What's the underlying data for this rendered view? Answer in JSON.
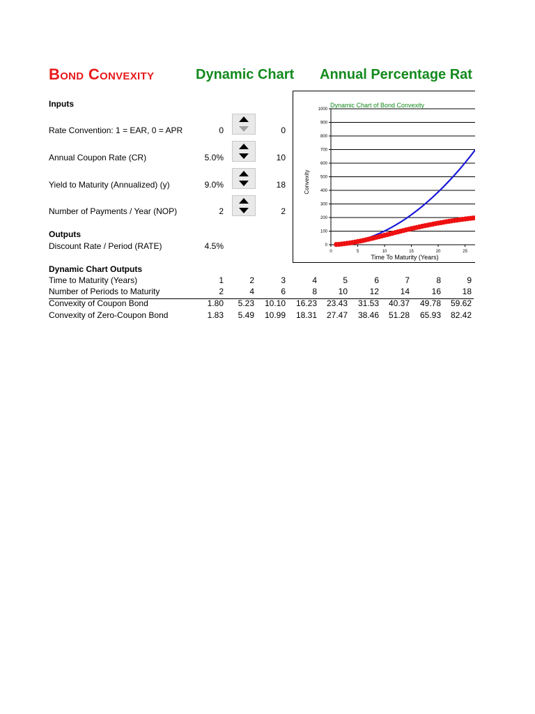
{
  "header": {
    "title": "Bond Convexity",
    "dynamic_chart": "Dynamic Chart",
    "annual_rate": "Annual Percentage Rat"
  },
  "inputs": {
    "heading": "Inputs",
    "rate_convention": {
      "label": "Rate Convention: 1 = EAR, 0 = APR",
      "value": "0",
      "spinner_value": "0"
    },
    "coupon_rate": {
      "label": "Annual Coupon Rate (CR)",
      "value": "5.0%",
      "spinner_value": "10"
    },
    "ytm": {
      "label": "Yield to Maturity (Annualized) (y)",
      "value": "9.0%",
      "spinner_value": "18"
    },
    "nop": {
      "label": "Number of Payments / Year (NOP)",
      "value": "2",
      "spinner_value": "2"
    }
  },
  "outputs": {
    "heading": "Outputs",
    "rate": {
      "label": "Discount Rate / Period (RATE)",
      "value": "4.5%"
    }
  },
  "dynamic_outputs": {
    "heading": "Dynamic Chart Outputs",
    "rows": [
      {
        "label": "Time to Maturity (Years)",
        "values": [
          "1",
          "2",
          "3",
          "4",
          "5",
          "6",
          "7",
          "8",
          "9"
        ]
      },
      {
        "label": "Number of Periods to Maturity",
        "values": [
          "2",
          "4",
          "6",
          "8",
          "10",
          "12",
          "14",
          "16",
          "18"
        ]
      },
      {
        "label": "Convexity of Coupon Bond",
        "values": [
          "1.80",
          "5.23",
          "10.10",
          "16.23",
          "23.43",
          "31.53",
          "40.37",
          "49.78",
          "59.62"
        ]
      },
      {
        "label": "Convexity of Zero-Coupon Bond",
        "values": [
          "1.83",
          "5.49",
          "10.99",
          "18.31",
          "27.47",
          "38.46",
          "51.28",
          "65.93",
          "82.42"
        ]
      }
    ]
  },
  "chart_data": {
    "type": "scatter",
    "title": "Dynamic Chart of Bond Convexity",
    "xlabel": "Time To Maturity (Years)",
    "ylabel": "Convexity",
    "ylim": [
      0,
      1000
    ],
    "xlim": [
      0,
      27
    ],
    "x_ticks": [
      "0",
      "5",
      "10",
      "15",
      "20",
      "25"
    ],
    "y_ticks": [
      "0",
      "100",
      "200",
      "300",
      "400",
      "500",
      "600",
      "700",
      "800",
      "900",
      "1000"
    ],
    "grid": true,
    "series": [
      {
        "name": "",
        "style": "line",
        "color": "#1a1ad6",
        "x": [
          1,
          2,
          3,
          4,
          5,
          6,
          7,
          8,
          9,
          10,
          11,
          12,
          13,
          14,
          15,
          16,
          17,
          18,
          19,
          20,
          21,
          22,
          23,
          24,
          25,
          26,
          27
        ],
        "values": [
          1.83,
          5.49,
          10.99,
          18.31,
          27.47,
          38.46,
          51.28,
          65.93,
          82.42,
          100.7,
          121,
          143,
          167,
          193,
          221,
          251,
          282,
          316,
          351,
          388,
          427,
          468,
          511,
          556,
          603,
          652,
          703
        ]
      },
      {
        "name": "",
        "style": "markers",
        "color": "#ee1111",
        "x": [
          1,
          1.5,
          2,
          2.5,
          3,
          3.5,
          4,
          4.5,
          5,
          5.5,
          6,
          6.5,
          7,
          7.5,
          8,
          8.5,
          9,
          9.5,
          10,
          10.5,
          11,
          11.5,
          12,
          12.5,
          13,
          13.5,
          14,
          14.5,
          15,
          15.5,
          16,
          16.5,
          17,
          17.5,
          18,
          18.5,
          19,
          19.5,
          20,
          20.5,
          21,
          21.5,
          22,
          22.5,
          23,
          23.5,
          24,
          24.5,
          25,
          25.5,
          26,
          26.5,
          27
        ],
        "values": [
          1.8,
          3.3,
          5.23,
          7.5,
          10.1,
          13,
          16.23,
          19.7,
          23.43,
          27.4,
          31.53,
          35.9,
          40.37,
          45,
          49.78,
          54.7,
          59.62,
          64.6,
          69.6,
          74.6,
          79.6,
          84.6,
          89.6,
          94.5,
          99.4,
          104.2,
          109,
          113.7,
          118.3,
          122.8,
          127.2,
          131.5,
          135.7,
          139.8,
          143.8,
          147.7,
          151.5,
          155.2,
          158.8,
          162.3,
          165.7,
          169,
          172.2,
          175.3,
          178.3,
          181.2,
          184,
          186.7,
          189.3,
          191.8,
          194.2,
          196.5,
          198.7
        ]
      }
    ],
    "colors": {
      "grid": "#000000",
      "title": "#138a1d"
    }
  }
}
